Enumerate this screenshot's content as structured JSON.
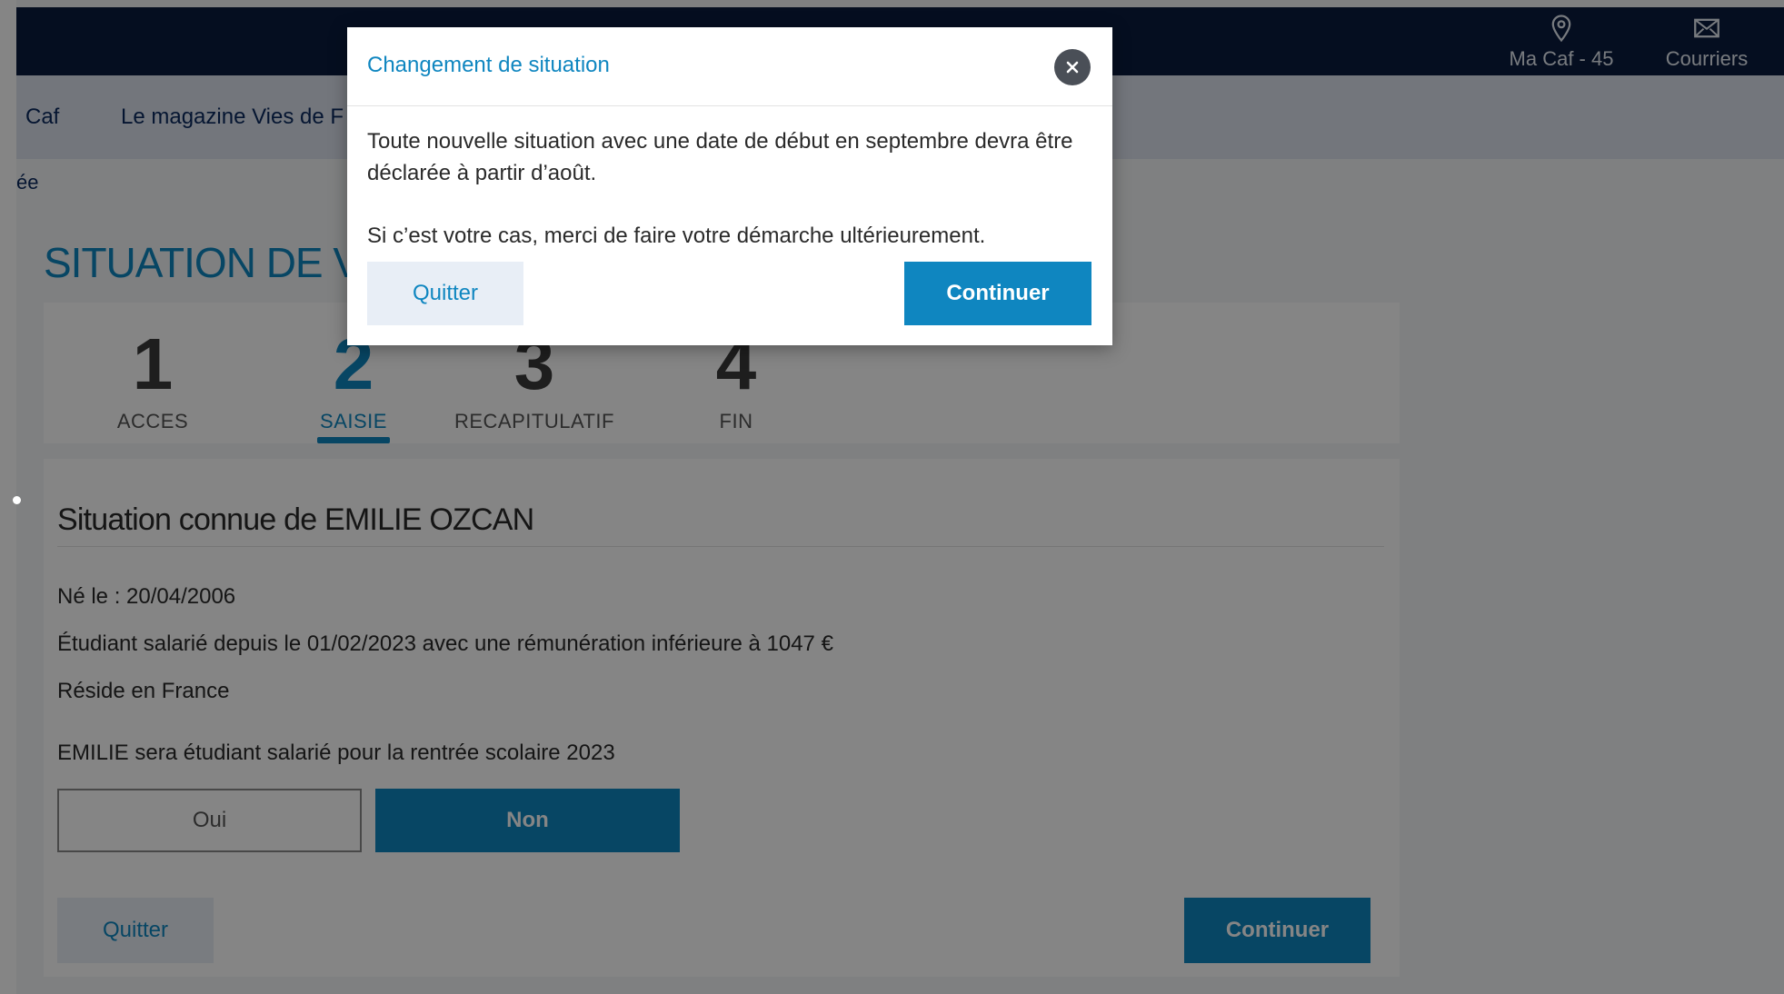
{
  "header": {
    "caf_link": "Ma Caf - 45",
    "mail_link": "Courriers",
    "icons": {
      "caf": "location-pin-icon",
      "mail": "envelope-icon",
      "close": "close-icon"
    }
  },
  "nav": {
    "items": [
      {
        "label": "Caf"
      },
      {
        "label": "Le magazine Vies de F"
      }
    ]
  },
  "breadcrumb": "ée",
  "page_title": "SITUATION DE VC",
  "steps": [
    {
      "num": "1",
      "label": "ACCES"
    },
    {
      "num": "2",
      "label": "SAISIE"
    },
    {
      "num": "3",
      "label": "RECAPITULATIF"
    },
    {
      "num": "4",
      "label": "FIN"
    }
  ],
  "card": {
    "title": "Situation connue de EMILIE OZCAN",
    "birth": "Né le : 20/04/2006",
    "status": "Étudiant salarié depuis le 01/02/2023 avec une rémunération inférieure à 1047 €",
    "residence": "Réside en France",
    "question": "EMILIE sera étudiant salarié pour la rentrée scolaire 2023",
    "yes": "Oui",
    "no": "Non",
    "quit": "Quitter",
    "continue": "Continuer"
  },
  "modal": {
    "title": "Changement de situation",
    "text1": "Toute nouvelle situation avec une date de début en septembre devra être déclarée à partir d’août.",
    "text2": "Si c’est votre cas, merci de faire votre démarche ultérieurement.",
    "quit": "Quitter",
    "continue": "Continuer"
  },
  "colors": {
    "accent": "#0f86c0",
    "topbar": "#0a1b3f",
    "navbar": "#dde3ee"
  }
}
